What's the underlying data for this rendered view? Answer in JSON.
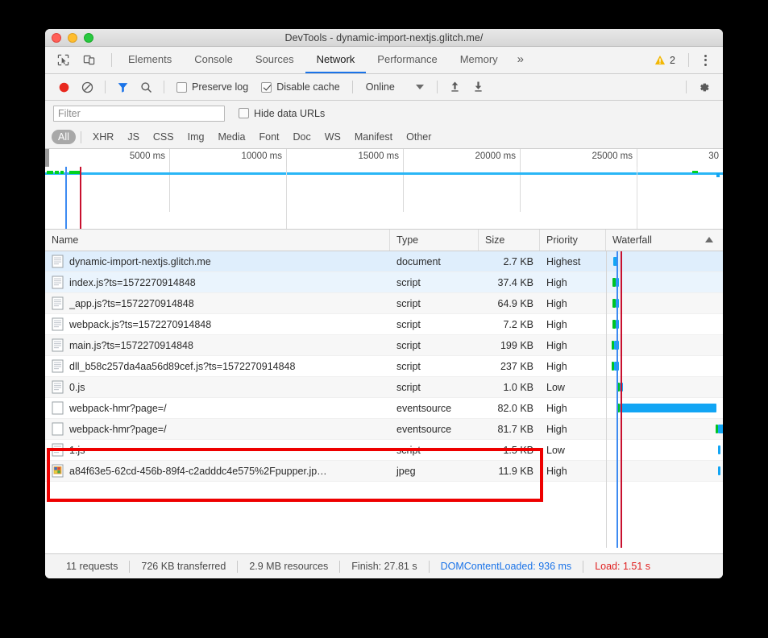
{
  "window": {
    "title": "DevTools - dynamic-import-nextjs.glitch.me/",
    "traffic_lights": [
      "close",
      "minimize",
      "maximize"
    ]
  },
  "tabbar": {
    "icons": [
      {
        "name": "inspect-element-icon"
      },
      {
        "name": "device-toolbar-icon"
      }
    ],
    "tabs": [
      {
        "label": "Elements",
        "active": false
      },
      {
        "label": "Console",
        "active": false
      },
      {
        "label": "Sources",
        "active": false
      },
      {
        "label": "Network",
        "active": true
      },
      {
        "label": "Performance",
        "active": false
      },
      {
        "label": "Memory",
        "active": false
      }
    ],
    "more_label": "»",
    "warning_count": "2",
    "warning_color": "#f2b705"
  },
  "toolbar": {
    "record_label": "record",
    "clear_label": "clear",
    "filter_label": "filter",
    "search_label": "search",
    "filter_icon_color": "#1a73e8",
    "record_color": "#e8281e",
    "preserve_log": {
      "label": "Preserve log",
      "checked": false
    },
    "disable_cache": {
      "label": "Disable cache",
      "checked": true
    },
    "throttle": {
      "value": "Online"
    },
    "import_label": "import-har",
    "export_label": "export-har",
    "settings_label": "settings"
  },
  "filterbar": {
    "placeholder": "Filter",
    "value": "",
    "hide_data_urls": {
      "label": "Hide data URLs",
      "checked": false
    }
  },
  "type_chips": [
    {
      "label": "All",
      "active": true
    },
    {
      "label": "XHR",
      "active": false
    },
    {
      "label": "JS",
      "active": false
    },
    {
      "label": "CSS",
      "active": false
    },
    {
      "label": "Img",
      "active": false
    },
    {
      "label": "Media",
      "active": false
    },
    {
      "label": "Font",
      "active": false
    },
    {
      "label": "Doc",
      "active": false
    },
    {
      "label": "WS",
      "active": false
    },
    {
      "label": "Manifest",
      "active": false
    },
    {
      "label": "Other",
      "active": false
    }
  ],
  "overview": {
    "ticks": [
      "5000 ms",
      "10000 ms",
      "15000 ms",
      "20000 ms",
      "25000 ms",
      "30"
    ],
    "dcl_marker_color": "#3d8bf2",
    "load_marker_color": "#c8102e",
    "network_line_color": "#29b6f6"
  },
  "table": {
    "columns": [
      "Name",
      "Type",
      "Size",
      "Priority",
      "Waterfall"
    ],
    "sort_indicator": "ascending",
    "rows": [
      {
        "icon": "document-file-icon",
        "name": "dynamic-import-nextjs.glitch.me",
        "type": "document",
        "size": "2.7 KB",
        "priority": "Highest"
      },
      {
        "icon": "script-file-icon",
        "name": "index.js?ts=1572270914848",
        "type": "script",
        "size": "37.4 KB",
        "priority": "High"
      },
      {
        "icon": "script-file-icon",
        "name": "_app.js?ts=1572270914848",
        "type": "script",
        "size": "64.9 KB",
        "priority": "High"
      },
      {
        "icon": "script-file-icon",
        "name": "webpack.js?ts=1572270914848",
        "type": "script",
        "size": "7.2 KB",
        "priority": "High"
      },
      {
        "icon": "script-file-icon",
        "name": "main.js?ts=1572270914848",
        "type": "script",
        "size": "199 KB",
        "priority": "High"
      },
      {
        "icon": "script-file-icon",
        "name": "dll_b58c257da4aa56d89cef.js?ts=1572270914848",
        "type": "script",
        "size": "237 KB",
        "priority": "High"
      },
      {
        "icon": "script-file-icon",
        "name": "0.js",
        "type": "script",
        "size": "1.0 KB",
        "priority": "Low"
      },
      {
        "icon": "blank-file-icon",
        "name": "webpack-hmr?page=/",
        "type": "eventsource",
        "size": "82.0 KB",
        "priority": "High"
      },
      {
        "icon": "blank-file-icon",
        "name": "webpack-hmr?page=/",
        "type": "eventsource",
        "size": "81.7 KB",
        "priority": "High"
      },
      {
        "icon": "script-file-icon",
        "name": "1.js",
        "type": "script",
        "size": "1.5 KB",
        "priority": "Low"
      },
      {
        "icon": "image-file-icon",
        "name": "a84f63e5-62cd-456b-89f4-c2adddc4e575%2Fpupper.jp…",
        "type": "jpeg",
        "size": "11.9 KB",
        "priority": "High"
      }
    ]
  },
  "annotation": {
    "color": "#ee0000",
    "highlights_rows": [
      "1.js",
      "a84f63e5-62cd-456b-89f4-c2adddc4e575%2Fpupper.jp…"
    ]
  },
  "footer": {
    "requests": "11 requests",
    "transferred": "726 KB transferred",
    "resources": "2.9 MB resources",
    "finish": "Finish: 27.81 s",
    "dom_content_loaded": "DOMContentLoaded: 936 ms",
    "load": "Load: 1.51 s",
    "dcl_color": "#1a73e8",
    "load_color": "#e02020"
  }
}
